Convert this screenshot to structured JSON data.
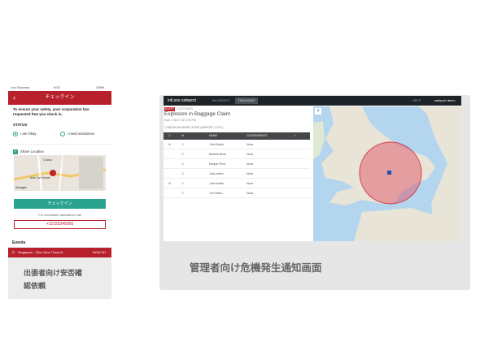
{
  "phone": {
    "status_bar": {
      "carrier": "••••• Docomo",
      "time": "9:02",
      "battery": "100%"
    },
    "header_title": "チェックイン",
    "safety_message": "To ensure your safety, your corporation has requested that you check in.",
    "status_label": "STATUS",
    "options": [
      "I am Okay",
      "I need assistance"
    ],
    "share_location": "Share Location",
    "map_labels": [
      "Costco",
      "Avis Car Rental",
      "Google"
    ],
    "checkin_button": "チェックイン",
    "assist_label": "For immediate assistance call",
    "phone_number": "+12155345000",
    "events_label": "Events",
    "event": "Singapore - Zika Virus Travel A...",
    "event_time": "NOW 4H",
    "caption_line1": "出張者向け安否確",
    "caption_line2": "認依頼"
  },
  "desktop": {
    "logo": "intl.sos safeport",
    "nav": [
      "INCIDENTS",
      "TRACKING"
    ],
    "user": "HELP",
    "account": "safeport demo",
    "alert_badge": "ALERT",
    "alert_type": "CUSTOMER",
    "incident_title": "Explosion in Baggage Claim",
    "incident_meta": "Sept 1 08:07:32 2:09 PM",
    "list_label": "LONDON INCIDENT ZONE (AIRPORT 12 PL)",
    "columns": [
      "NAME",
      "CONVENIENCE"
    ],
    "rows": [
      {
        "flag": "✉",
        "name": "John Martin",
        "status": "None"
      },
      {
        "flag": "",
        "name": "Mamell Mean",
        "status": "None"
      },
      {
        "flag": "",
        "name": "Ranjae Perel",
        "status": "None"
      },
      {
        "flag": "",
        "name": "John artten",
        "status": "None"
      },
      {
        "flag": "✉",
        "name": "John Martin",
        "status": "None"
      },
      {
        "flag": "",
        "name": "Yoel Marin",
        "status": "None"
      }
    ],
    "caption": "管理者向け危機発生通知画面"
  },
  "colors": {
    "brand_red": "#b8202b",
    "teal": "#2aa38f",
    "dark_bar": "#1f2428"
  }
}
